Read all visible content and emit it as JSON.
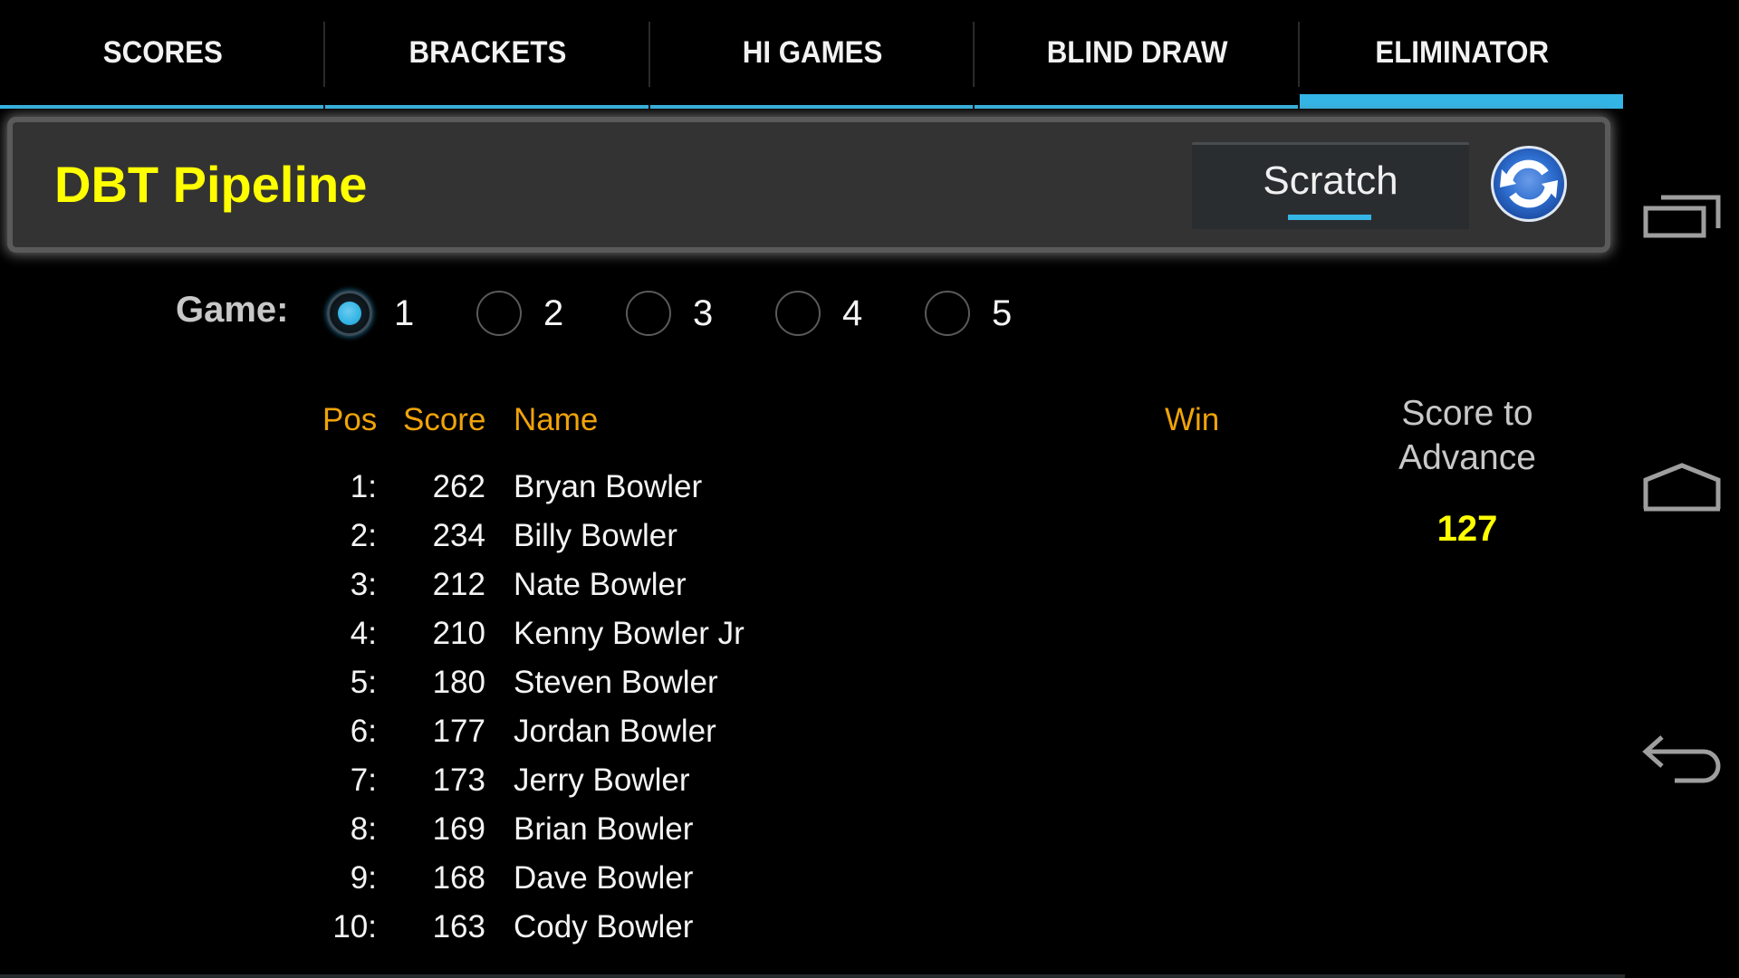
{
  "tabs": [
    {
      "label": "SCORES",
      "active": false
    },
    {
      "label": "BRACKETS",
      "active": false
    },
    {
      "label": "HI GAMES",
      "active": false
    },
    {
      "label": "BLIND DRAW",
      "active": false
    },
    {
      "label": "ELIMINATOR",
      "active": true
    }
  ],
  "header": {
    "title": "DBT Pipeline",
    "scratch_label": "Scratch",
    "refresh_icon": "refresh-icon"
  },
  "game_selector": {
    "label": "Game:",
    "options": [
      "1",
      "2",
      "3",
      "4",
      "5"
    ],
    "selected": "1"
  },
  "table": {
    "headers": {
      "pos": "Pos",
      "score": "Score",
      "name": "Name",
      "win": "Win"
    },
    "rows": [
      {
        "pos": "1:",
        "score": "262",
        "name": "Bryan Bowler"
      },
      {
        "pos": "2:",
        "score": "234",
        "name": "Billy Bowler"
      },
      {
        "pos": "3:",
        "score": "212",
        "name": "Nate Bowler"
      },
      {
        "pos": "4:",
        "score": "210",
        "name": "Kenny Bowler Jr"
      },
      {
        "pos": "5:",
        "score": "180",
        "name": "Steven Bowler"
      },
      {
        "pos": "6:",
        "score": "177",
        "name": "Jordan Bowler"
      },
      {
        "pos": "7:",
        "score": "173",
        "name": "Jerry Bowler"
      },
      {
        "pos": "8:",
        "score": "169",
        "name": "Brian Bowler"
      },
      {
        "pos": "9:",
        "score": "168",
        "name": "Dave Bowler"
      },
      {
        "pos": "10:",
        "score": "163",
        "name": "Cody Bowler"
      }
    ]
  },
  "advance": {
    "label_line1": "Score to",
    "label_line2": "Advance",
    "value": "127"
  },
  "navbar": {
    "icons": [
      "recent-apps-icon",
      "home-icon",
      "back-icon"
    ]
  },
  "colors": {
    "accent": "#33b5e5",
    "title": "#ffff00",
    "column_header": "#f0a30a",
    "panel": "#333333"
  }
}
